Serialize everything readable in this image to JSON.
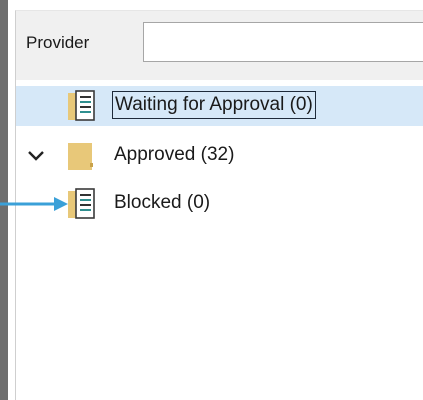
{
  "provider": {
    "label": "Provider",
    "value": "",
    "placeholder": ""
  },
  "tree": {
    "items": [
      {
        "label": "Waiting for Approval (0)",
        "icon": "document-folder-icon",
        "selected": true
      },
      {
        "label": "Approved (32)",
        "icon": "folder-icon",
        "expanded": true
      },
      {
        "label": "Blocked (0)",
        "icon": "document-folder-icon"
      }
    ]
  },
  "colors": {
    "selection": "#d6e8f8",
    "arrow": "#3aa0d8",
    "folder": "#e8c879"
  }
}
